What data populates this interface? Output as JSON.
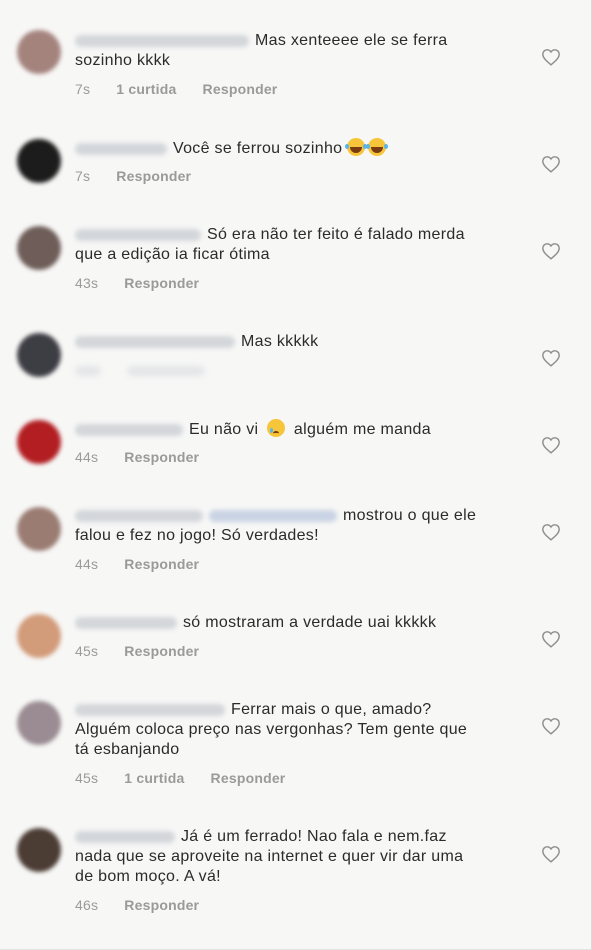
{
  "comments": [
    {
      "text_lines": [
        "Mas xenteeee ele se ferra",
        "sozinho kkkk"
      ],
      "time": "7s",
      "likes": "1 curtida",
      "reply": "Responder",
      "avatar_color": "#a4837d"
    },
    {
      "text_lines": [
        "Você se ferrou sozinho"
      ],
      "emojis": [
        "face-with-tears-of-joy-icon",
        "face-with-tears-of-joy-icon"
      ],
      "time": "7s",
      "reply": "Responder",
      "avatar_color": "#1c1c1c"
    },
    {
      "text_lines": [
        "Só era não ter feito é falado merda",
        "que a edição ia ficar ótima"
      ],
      "time": "43s",
      "reply": "Responder",
      "avatar_color": "#6e5d58"
    },
    {
      "text_lines": [
        "Mas kkkkk"
      ],
      "time": "",
      "reply": "",
      "avatar_color": "#3d3d44"
    },
    {
      "text_lines": [
        "Eu não vi",
        "alguém me manda"
      ],
      "emojis": [
        "crying-face-icon"
      ],
      "time": "44s",
      "reply": "Responder",
      "avatar_color": "#b21e22"
    },
    {
      "text_lines": [
        "mostrou o que ele",
        "falou e fez no jogo! Só verdades!"
      ],
      "time": "44s",
      "reply": "Responder",
      "avatar_color": "#9a7c72"
    },
    {
      "text_lines": [
        "só mostraram a verdade uai kkkkk"
      ],
      "time": "45s",
      "reply": "Responder",
      "avatar_color": "#d29b7a"
    },
    {
      "text_lines": [
        "Ferrar mais o que, amado?",
        "Alguém coloca preço nas vergonhas? Tem gente que",
        "tá esbanjando"
      ],
      "time": "45s",
      "likes": "1 curtida",
      "reply": "Responder",
      "avatar_color": "#9a8c92"
    },
    {
      "text_lines": [
        "Já é um ferrado! Nao fala e nem.faz",
        "nada que se aproveite na internet e quer vir dar uma",
        "de bom moço.  A vá!"
      ],
      "time": "46s",
      "reply": "Responder",
      "avatar_color": "#4b3c34"
    }
  ],
  "colors": {
    "text": "#262626",
    "meta": "#9b9b9b",
    "background": "#f7f7f6",
    "heart": "#8e8e8e"
  }
}
